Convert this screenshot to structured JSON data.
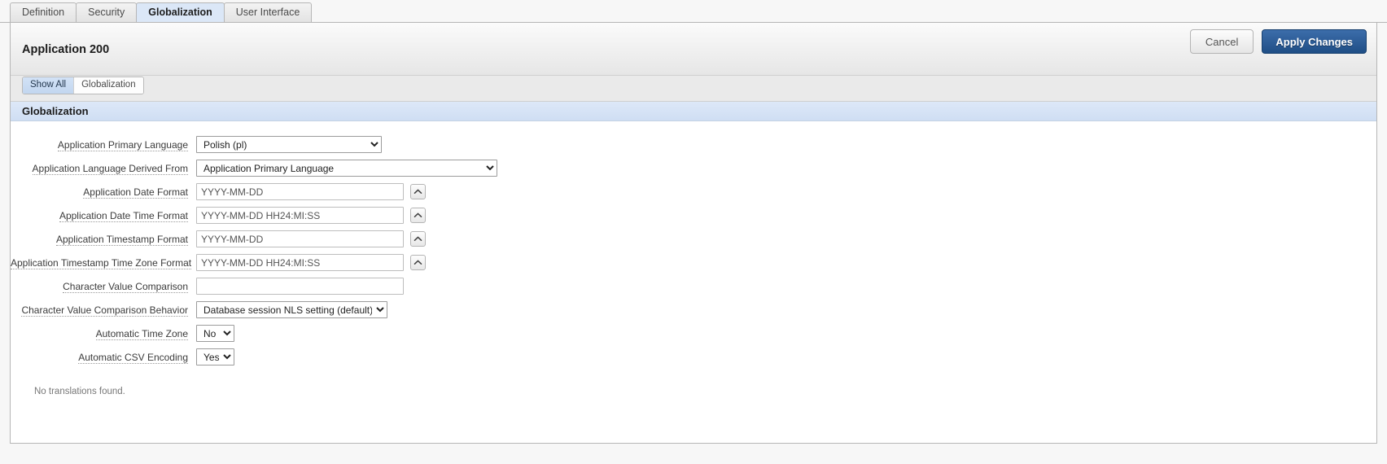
{
  "tabs": [
    {
      "label": "Definition",
      "active": false
    },
    {
      "label": "Security",
      "active": false
    },
    {
      "label": "Globalization",
      "active": true
    },
    {
      "label": "User Interface",
      "active": false
    }
  ],
  "header": {
    "title": "Application 200",
    "cancel_label": "Cancel",
    "apply_label": "Apply Changes"
  },
  "pills": [
    {
      "label": "Show All",
      "active": true
    },
    {
      "label": "Globalization",
      "active": false
    }
  ],
  "section": {
    "title": "Globalization"
  },
  "fields": [
    {
      "label": "Application Primary Language",
      "type": "select",
      "value": "Polish (pl)",
      "width": "w228"
    },
    {
      "label": "Application Language Derived From",
      "type": "select",
      "value": "Application Primary Language",
      "width": "w370"
    },
    {
      "label": "Application Date Format",
      "type": "text",
      "value": "YYYY-MM-DD",
      "popup": true
    },
    {
      "label": "Application Date Time Format",
      "type": "text",
      "value": "YYYY-MM-DD HH24:MI:SS",
      "popup": true
    },
    {
      "label": "Application Timestamp Format",
      "type": "text",
      "value": "YYYY-MM-DD",
      "popup": true
    },
    {
      "label": "Application Timestamp Time Zone Format",
      "type": "text",
      "value": "YYYY-MM-DD HH24:MI:SS",
      "popup": true
    },
    {
      "label": "Character Value Comparison",
      "type": "text",
      "value": "",
      "popup": false
    },
    {
      "label": "Character Value Comparison Behavior",
      "type": "select",
      "value": "Database session NLS setting (default)",
      "width": "w235"
    },
    {
      "label": "Automatic Time Zone",
      "type": "select",
      "value": "No",
      "width": "w47"
    },
    {
      "label": "Automatic CSV Encoding",
      "type": "select",
      "value": "Yes",
      "width": "w47"
    }
  ],
  "footer": {
    "no_translations": "No translations found."
  },
  "icons": {
    "popup_lov": "chevron-up-icon",
    "dropdown": "chevron-down-icon"
  },
  "colors": {
    "accent_blue": "#1f4e86",
    "section_band": "#d3e0f2",
    "active_tab": "#dbe7f7",
    "page_bg": "#f7f7f7"
  }
}
